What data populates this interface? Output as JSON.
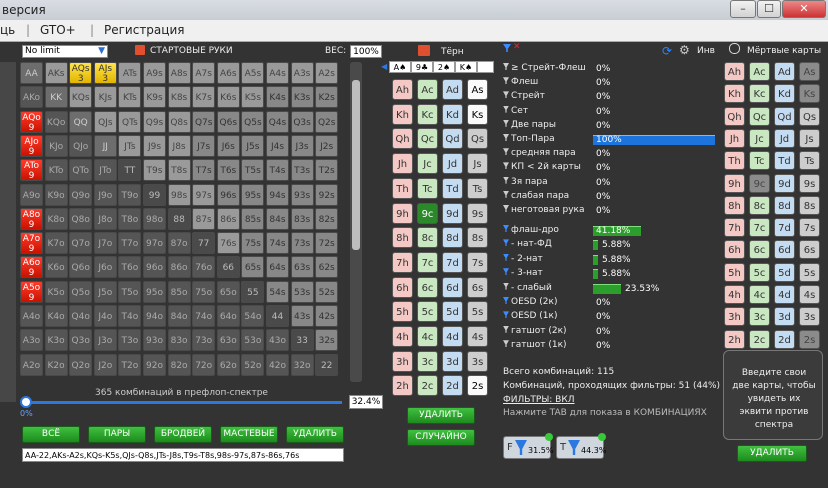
{
  "window": {
    "title": "версия",
    "min": "–",
    "max": "☐",
    "close": "✕"
  },
  "menu": [
    "ць",
    "GTO+",
    "Регистрация"
  ],
  "toolbar": {
    "mode": "No limit",
    "starting_hands": "СТАРТОВЫЕ РУКИ",
    "weight_label": "ВЕС:",
    "weight_value": "100%"
  },
  "grid": [
    [
      "AA",
      "AKs",
      "AQs 3",
      "AJs 3",
      "ATs",
      "A9s",
      "A8s",
      "A7s",
      "A6s",
      "A5s",
      "A4s",
      "A3s",
      "A2s"
    ],
    [
      "AKo",
      "KK",
      "KQs",
      "KJs",
      "KTs",
      "K9s",
      "K8s",
      "K7s",
      "K6s",
      "K5s",
      "K4s",
      "K3s",
      "K2s"
    ],
    [
      "AQo 9",
      "KQo",
      "QQ",
      "QJs",
      "QTs",
      "Q9s",
      "Q8s",
      "Q7s",
      "Q6s",
      "Q5s",
      "Q4s",
      "Q3s",
      "Q2s"
    ],
    [
      "AJo 9",
      "KJo",
      "QJo",
      "JJ",
      "JTs",
      "J9s",
      "J8s",
      "J7s",
      "J6s",
      "J5s",
      "J4s",
      "J3s",
      "J2s"
    ],
    [
      "ATo 9",
      "KTo",
      "QTo",
      "JTo",
      "TT",
      "T9s",
      "T8s",
      "T7s",
      "T6s",
      "T5s",
      "T4s",
      "T3s",
      "T2s"
    ],
    [
      "A9o",
      "K9o",
      "Q9o",
      "J9o",
      "T9o",
      "99",
      "98s",
      "97s",
      "96s",
      "95s",
      "94s",
      "93s",
      "92s"
    ],
    [
      "A8o 9",
      "K8o",
      "Q8o",
      "J8o",
      "T8o",
      "98o",
      "88",
      "87s",
      "86s",
      "85s",
      "84s",
      "83s",
      "82s"
    ],
    [
      "A7o 9",
      "K7o",
      "Q7o",
      "J7o",
      "T7o",
      "97o",
      "87o",
      "77",
      "76s",
      "75s",
      "74s",
      "73s",
      "72s"
    ],
    [
      "A6o 9",
      "K6o",
      "Q6o",
      "J6o",
      "T6o",
      "96o",
      "86o",
      "76o",
      "66",
      "65s",
      "64s",
      "63s",
      "62s"
    ],
    [
      "A5o 9",
      "K5o",
      "Q5o",
      "J5o",
      "T5o",
      "95o",
      "85o",
      "75o",
      "65o",
      "55",
      "54s",
      "53s",
      "52s"
    ],
    [
      "A4o",
      "K4o",
      "Q4o",
      "J4o",
      "T4o",
      "94o",
      "84o",
      "74o",
      "64o",
      "54o",
      "44",
      "43s",
      "42s"
    ],
    [
      "A3o",
      "K3o",
      "Q3o",
      "J3o",
      "T3o",
      "93o",
      "83o",
      "73o",
      "63o",
      "53o",
      "43o",
      "33",
      "32s"
    ],
    [
      "A2o",
      "K2o",
      "Q2o",
      "J2o",
      "T2o",
      "92o",
      "82o",
      "72o",
      "62o",
      "52o",
      "42o",
      "32o",
      "22"
    ]
  ],
  "combos_text": "365 комбинаций в префлоп-спектре",
  "slider": {
    "min_label": "0%",
    "value": "32.4%",
    "fraction": 0.324
  },
  "buttons": [
    "ВСЁ",
    "ПАРЫ",
    "БРОДВЕЙ",
    "МАСТЕВЫЕ",
    "УДАЛИТЬ"
  ],
  "range_text": "AA-22,AKs-A2s,KQs-K5s,QJs-Q8s,JTs-J8s,T9s-T8s,98s-97s,87s-86s,76s",
  "board": {
    "title": "Тёрн",
    "cards": [
      "A♠",
      "9♣",
      "2♠",
      "K♠"
    ]
  },
  "card_columns": {
    "ranks": [
      "A",
      "K",
      "Q",
      "J",
      "T",
      "9",
      "8",
      "7",
      "6",
      "5",
      "4",
      "3",
      "2"
    ],
    "suits": [
      "h",
      "c",
      "d",
      "s"
    ]
  },
  "board_buttons": {
    "delete": "УДАЛИТЬ",
    "random": "СЛУЧАЙНО"
  },
  "stats_header": {
    "ev_label": "Инв"
  },
  "stats": [
    {
      "label": "≥ Стрейт-Флеш",
      "value": "0%"
    },
    {
      "label": "Флеш",
      "value": "0%"
    },
    {
      "label": "Стрейт",
      "value": "0%"
    },
    {
      "label": "Сет",
      "value": "0%"
    },
    {
      "label": "Две пары",
      "value": "0%"
    },
    {
      "label": "Топ-Пара",
      "value": "100%"
    },
    {
      "label": "средняя пара",
      "value": "0%"
    },
    {
      "label": "КП < 2й карты",
      "value": "0%"
    },
    {
      "label": "3я пара",
      "value": "0%"
    },
    {
      "label": "слабая пара",
      "value": "0%"
    },
    {
      "label": "неготовая рука",
      "value": "0%"
    }
  ],
  "draws": [
    {
      "label": "флаш-дро",
      "value": "41.18%"
    },
    {
      "label": "- нат-ФД",
      "value": "5.88%"
    },
    {
      "label": "- 2-нат",
      "value": "5.88%"
    },
    {
      "label": "- 3-нат",
      "value": "5.88%"
    },
    {
      "label": "- слабый",
      "value": "23.53%"
    },
    {
      "label": "OESD (2к)",
      "value": "0%"
    },
    {
      "label": "OESD (1к)",
      "value": "0%"
    },
    {
      "label": "гатшот (2к)",
      "value": "0%"
    },
    {
      "label": "гатшот (1к)",
      "value": "0%"
    }
  ],
  "summary": {
    "total": "Всего комбинаций: 115",
    "passing": "Комбинаций, проходящих фильтры: 51 (44%)",
    "filters": "ФИЛЬТРЫ: ВКЛ",
    "hint": "Нажмите TAB для показа в КОМБИНАЦИЯХ"
  },
  "filter_badges": [
    {
      "letter": "F",
      "value": "31.5%"
    },
    {
      "letter": "T",
      "value": "44.3%"
    }
  ],
  "dead_cards": {
    "title": "Мёртвые карты",
    "hint": "Введите свои две карты, чтобы увидеть их эквити против спектра",
    "delete": "УДАЛИТЬ"
  }
}
